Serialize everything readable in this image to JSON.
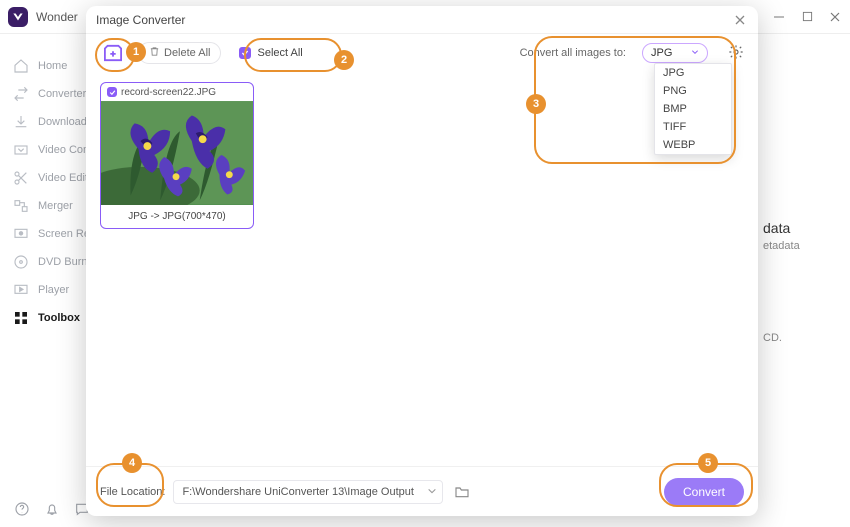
{
  "main": {
    "title": "Wonder",
    "sidebar": [
      {
        "label": "Home",
        "icon": "home"
      },
      {
        "label": "Converter",
        "icon": "convert"
      },
      {
        "label": "Downloader",
        "icon": "download"
      },
      {
        "label": "Video Compressor",
        "icon": "compress"
      },
      {
        "label": "Video Editor",
        "icon": "scissors"
      },
      {
        "label": "Merger",
        "icon": "merge"
      },
      {
        "label": "Screen Recorder",
        "icon": "record"
      },
      {
        "label": "DVD Burner",
        "icon": "disc"
      },
      {
        "label": "Player",
        "icon": "play"
      },
      {
        "label": "Toolbox",
        "icon": "grid"
      }
    ],
    "right_panel": {
      "title": "data",
      "subtitle": "etadata",
      "line": "CD."
    }
  },
  "dialog": {
    "title": "Image Converter",
    "toolbar": {
      "delete_all": "Delete All",
      "select_all": "Select All",
      "convert_to_label": "Convert all images to:",
      "selected_format": "JPG",
      "format_options": [
        "JPG",
        "PNG",
        "BMP",
        "TIFF",
        "WEBP"
      ]
    },
    "items": [
      {
        "filename": "record-screen22.JPG",
        "caption": "JPG -> JPG(700*470)"
      }
    ],
    "footer": {
      "file_location_label": "File Location:",
      "file_location_value": "F:\\Wondershare UniConverter 13\\Image Output",
      "convert_label": "Convert"
    }
  },
  "annotations": [
    "1",
    "2",
    "3",
    "4",
    "5"
  ]
}
